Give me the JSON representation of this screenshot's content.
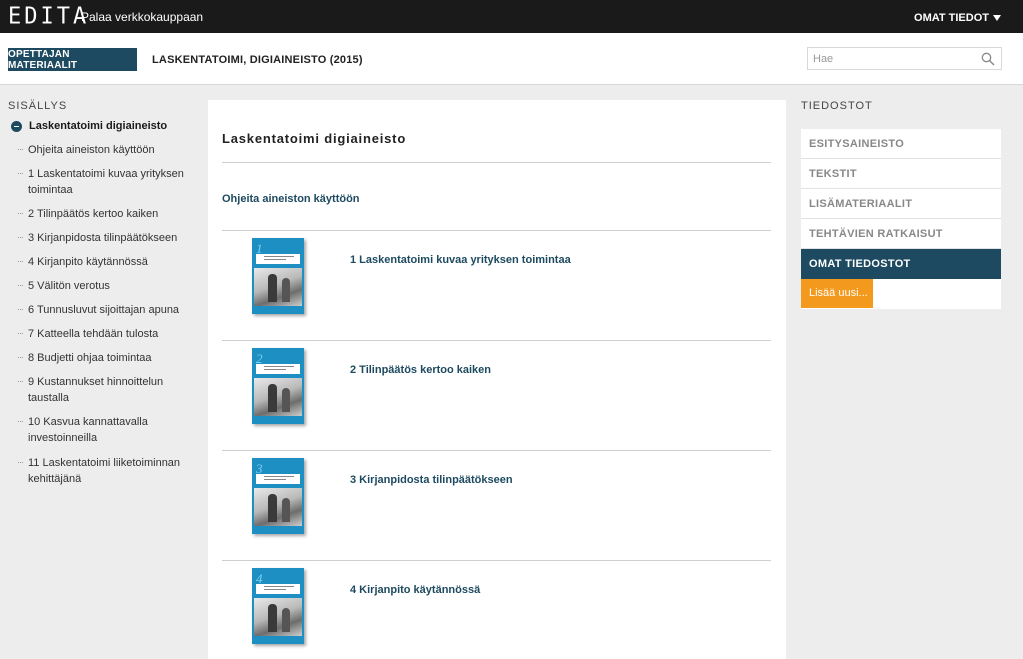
{
  "topbar": {
    "logo": "EDITA",
    "back_link": "Palaa verkkokauppaan",
    "account": "OMAT TIEDOT"
  },
  "header": {
    "teacher_button": "OPETTAJAN MATERIAALIT",
    "product_title": "LASKENTATOIMI, DIGIAINEISTO (2015)",
    "search_placeholder": "Hae"
  },
  "sidebar": {
    "heading": "SISÄLLYS",
    "root": "Laskentatoimi digiaineisto",
    "items": [
      "Ohjeita aineiston käyttöön",
      "1 Laskentatoimi kuvaa yrityksen toimintaa",
      "2 Tilinpäätös kertoo kaiken",
      "3 Kirjanpidosta tilinpäätökseen",
      "4 Kirjanpito käytännössä",
      "5 Välitön verotus",
      "6 Tunnusluvut sijoittajan apuna",
      "7 Katteella tehdään tulosta",
      "8 Budjetti ohjaa toimintaa",
      "9 Kustannukset hinnoittelun taustalla",
      "10 Kasvua kannattavalla investoinneilla",
      "11 Laskentatoimi liiketoiminnan kehittäjänä"
    ]
  },
  "main": {
    "title": "Laskentatoimi digiaineisto",
    "help_link": "Ohjeita aineiston käyttöön",
    "chapters": [
      {
        "number": "1",
        "title": "1 Laskentatoimi kuvaa yrityksen toimintaa"
      },
      {
        "number": "2",
        "title": "2 Tilinpäätös kertoo kaiken"
      },
      {
        "number": "3",
        "title": "3 Kirjanpidosta tilinpäätökseen"
      },
      {
        "number": "4",
        "title": "4 Kirjanpito käytännössä"
      }
    ]
  },
  "files": {
    "heading": "TIEDOSTOT",
    "items": [
      "ESITYSAINEISTO",
      "TEKSTIT",
      "LISÄMATERIAALIT",
      "TEHTÄVIEN RATKAISUT",
      "OMAT TIEDOSTOT"
    ],
    "active_index": 4,
    "add_new": "Lisää uusi..."
  },
  "colors": {
    "topbar": "#1a1a1a",
    "accent_dark_blue": "#1d4a60",
    "cover_blue": "#1d8fc3",
    "add_orange": "#f39a1e"
  }
}
